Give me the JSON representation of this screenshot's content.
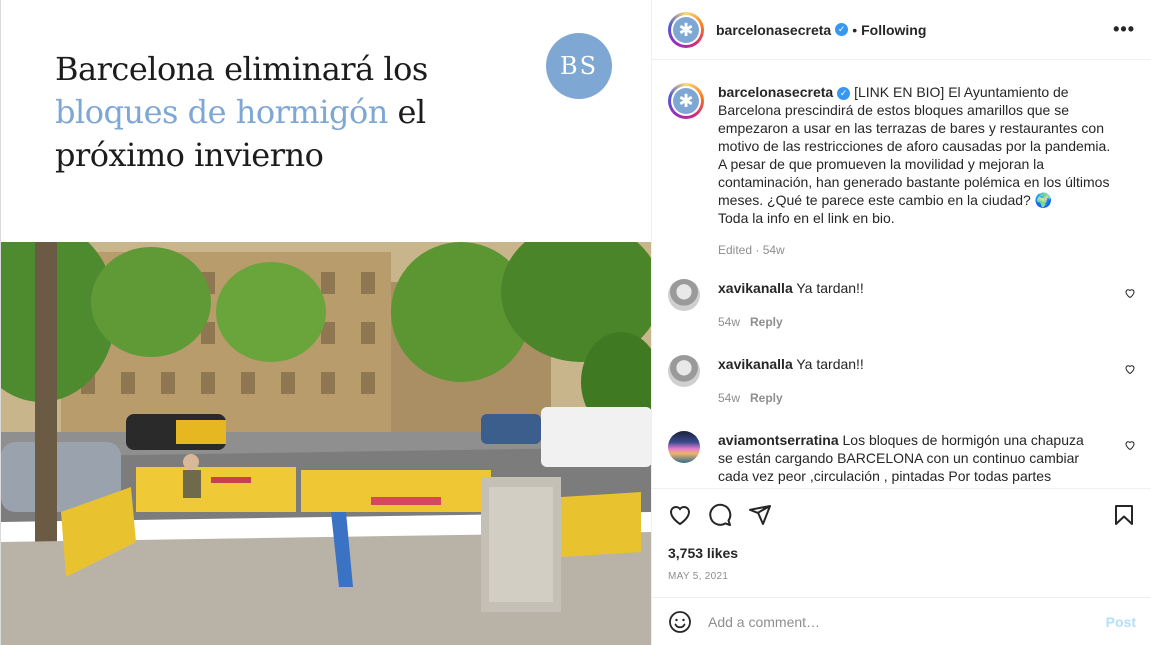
{
  "post_image": {
    "headline_line1": "Barcelona eliminará los",
    "headline_highlight": "bloques de hormigón",
    "headline_after_highlight": " el",
    "headline_line3": "próximo invierno",
    "badge": "BS",
    "accent_color": "#7ea7d4"
  },
  "header": {
    "username": "barcelonasecreta",
    "separator": "•",
    "follow_status": "Following",
    "more_icon": "ellipsis-icon"
  },
  "caption": {
    "username": "barcelonasecreta",
    "text": "[LINK EN BIO] El Ayuntamiento de Barcelona prescindirá de estos bloques amarillos que se empezaron a usar en las terrazas de bares y restaurantes con motivo de las restricciones de aforo causadas por la pandemia. A pesar de que promueven la movilidad y mejoran la contaminación, han generado bastante polémica en los últimos meses. ¿Qué te parece este cambio en la ciudad? 🌍",
    "text2": "Toda la info en el link en bio.",
    "meta": "Edited · 54w"
  },
  "comments": [
    {
      "username": "xavikanalla",
      "text": "Ya tardan!!",
      "time": "54w",
      "reply": "Reply"
    },
    {
      "username": "xavikanalla",
      "text": "Ya tardan!!",
      "time": "54w",
      "reply": "Reply"
    },
    {
      "username": "aviamontserratina",
      "text": "Los bloques de hormigón una chapuza se están cargando BARCELONA con un continuo cambiar cada vez peor ,circulación , pintadas Por todas partes"
    }
  ],
  "actions": {
    "likes": "3,753 likes",
    "date": "MAY 5, 2021"
  },
  "add_comment": {
    "placeholder": "Add a comment…",
    "post_label": "Post"
  }
}
